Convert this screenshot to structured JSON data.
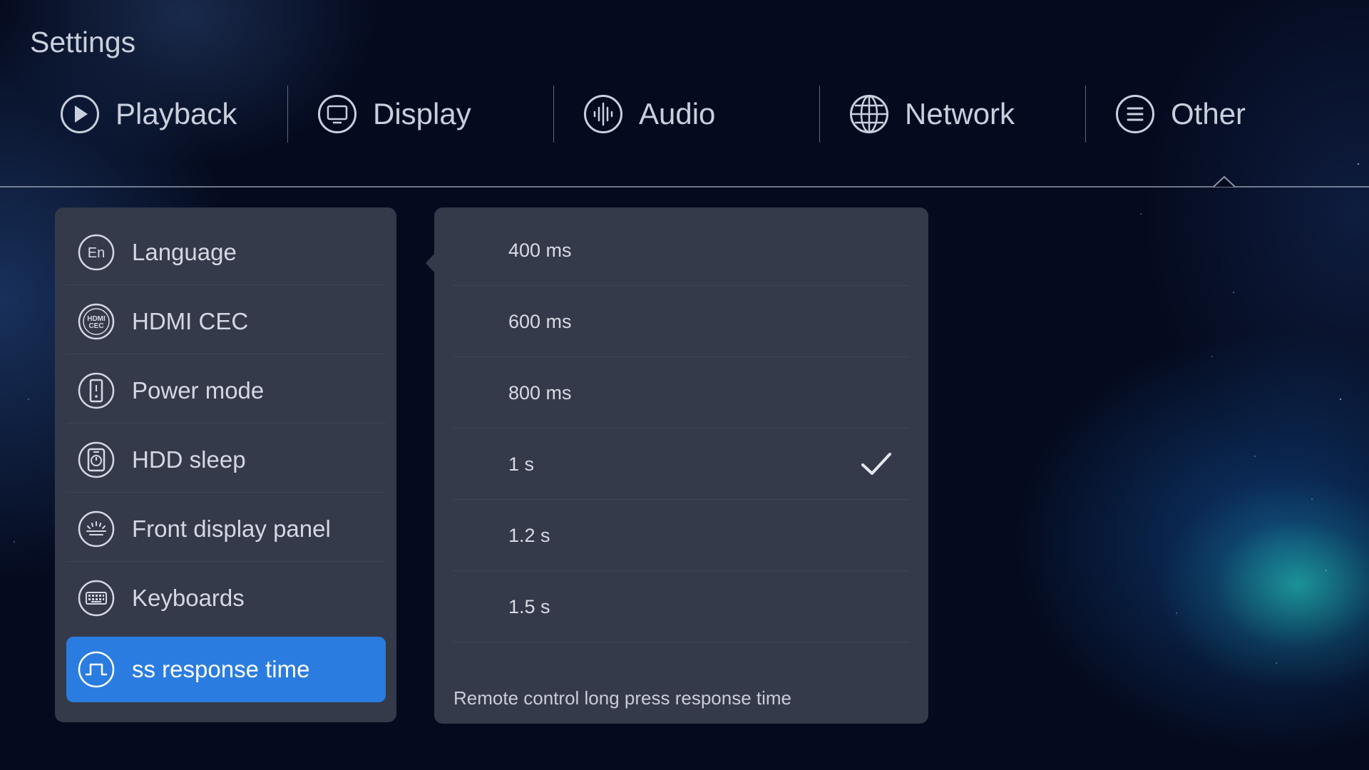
{
  "page_title": "Settings",
  "tabs": [
    {
      "label": "Playback",
      "icon": "play-icon"
    },
    {
      "label": "Display",
      "icon": "monitor-icon"
    },
    {
      "label": "Audio",
      "icon": "audio-wave-icon"
    },
    {
      "label": "Network",
      "icon": "globe-icon"
    },
    {
      "label": "Other",
      "icon": "menu-icon"
    }
  ],
  "active_tab": "Other",
  "menu": {
    "items": [
      {
        "label": "Language",
        "icon": "language-en-icon"
      },
      {
        "label": "HDMI CEC",
        "icon": "hdmi-cec-icon"
      },
      {
        "label": "Power mode",
        "icon": "power-mode-icon"
      },
      {
        "label": "HDD sleep",
        "icon": "hdd-sleep-icon"
      },
      {
        "label": "Front display panel",
        "icon": "front-display-icon"
      },
      {
        "label": "Keyboards",
        "icon": "keyboard-icon"
      },
      {
        "label": "ss response time",
        "icon": "pulse-icon"
      }
    ],
    "active_index": 6
  },
  "options": {
    "items": [
      {
        "label": "400 ms",
        "selected": false
      },
      {
        "label": "600 ms",
        "selected": false
      },
      {
        "label": "800 ms",
        "selected": false
      },
      {
        "label": "1 s",
        "selected": true
      },
      {
        "label": "1.2 s",
        "selected": false
      },
      {
        "label": "1.5 s",
        "selected": false
      }
    ],
    "footer": "Remote control long press response time"
  },
  "colors": {
    "accent": "#2a7ce0",
    "panel": "#343a4a",
    "background": "#050b1f"
  }
}
